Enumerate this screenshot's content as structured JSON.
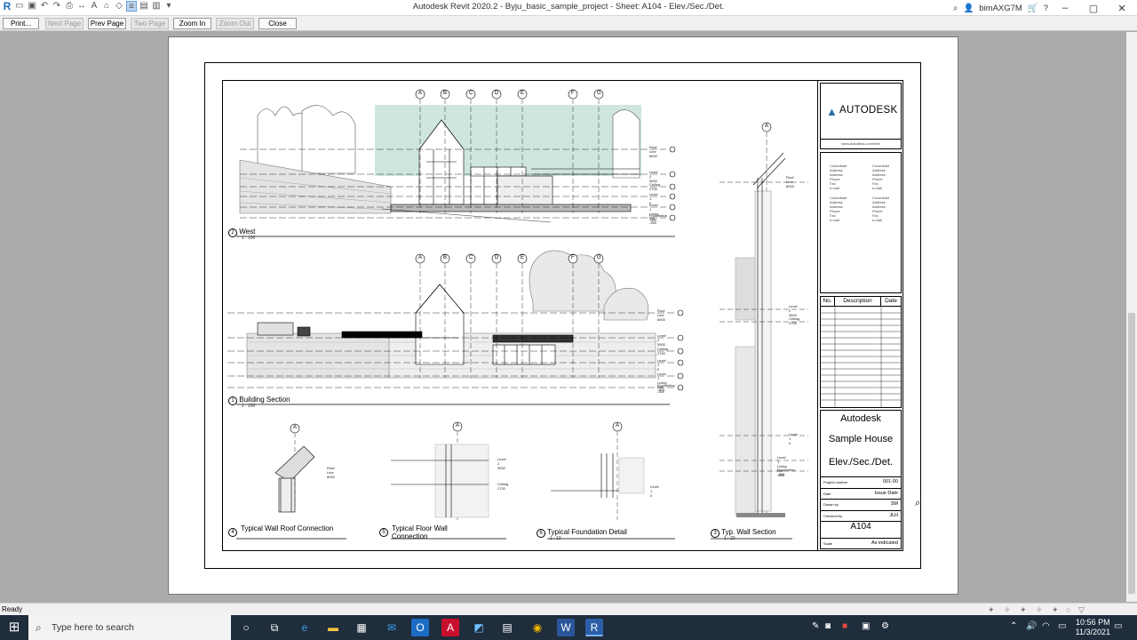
{
  "app": {
    "title": "Autodesk Revit 2020.2 - Byju_basic_sample_project - Sheet: A104 - Elev./Sec./Det.",
    "user": "bimAXG7M",
    "icons": [
      "revit-logo-icon",
      "open-icon",
      "save-icon",
      "undo-icon",
      "redo-icon",
      "print-icon",
      "measure-icon",
      "text-icon",
      "3d-view-icon",
      "sections-icon",
      "thin-lines-icon",
      "close-hidden-icon",
      "switch-windows-icon",
      "dropdown-icon"
    ]
  },
  "print_preview": {
    "buttons": [
      {
        "label": "Print...",
        "enabled": true
      },
      {
        "label": "Next Page",
        "enabled": false
      },
      {
        "label": "Prev Page",
        "enabled": true
      },
      {
        "label": "Two Page",
        "enabled": false
      },
      {
        "label": "Zoom In",
        "enabled": true
      },
      {
        "label": "Zoom Out",
        "enabled": false
      },
      {
        "label": "Close",
        "enabled": true
      }
    ]
  },
  "views": [
    {
      "number": "2",
      "name": "West",
      "scale": "1 : 100"
    },
    {
      "number": "1",
      "name": "Building Section",
      "scale": "1 : 100"
    },
    {
      "number": "4",
      "name": "Typical Wall Roof Connection",
      "scale": "1 : 10"
    },
    {
      "number": "5",
      "name": "Typical Floor Wall Connection",
      "scale": "1 : 10"
    },
    {
      "number": "6",
      "name": "Typical Foundation Detail",
      "scale": "1 : 10"
    },
    {
      "number": "3",
      "name": "Typ. Wall Section",
      "scale": "1 : 20"
    }
  ],
  "grids": [
    "A",
    "B",
    "C",
    "D",
    "E",
    "F",
    "G"
  ],
  "levels": [
    {
      "name": "Roof Line",
      "elev": "8000"
    },
    {
      "name": "Level 2",
      "elev": "3500"
    },
    {
      "name": "Ceiling",
      "elev": "2700"
    },
    {
      "name": "Level 1",
      "elev": "0"
    },
    {
      "name": "Level 1 Living Rm.",
      "elev": "-450"
    },
    {
      "name": "Foundation",
      "elev": "-900"
    }
  ],
  "title_block": {
    "company": "AUTODESK",
    "website": "www.autodesk.com/revit",
    "consultant_lines": [
      "Consultant",
      "Address",
      "Address",
      "Phone",
      "Fax",
      "e-mail"
    ],
    "revision_headers": {
      "no": "No.",
      "description": "Description",
      "date": "Date"
    },
    "project_line1": "Autodesk",
    "project_line2": "Sample House",
    "sheet_name": "Elev./Sec./Det.",
    "project_number_label": "Project number",
    "project_number": "001-00",
    "date_label": "Date",
    "date": "Issue Date",
    "drawn_by_label": "Drawn by",
    "drawn_by": "SM",
    "checked_by_label": "Checked by",
    "checked_by": "JLH",
    "sheet_number": "A104",
    "scale_label": "Scale",
    "scale": "As indicated"
  },
  "status": {
    "text": "Ready"
  },
  "taskbar": {
    "search_placeholder": "Type here to search",
    "time": "10:56 PM",
    "date": "11/3/2021"
  }
}
